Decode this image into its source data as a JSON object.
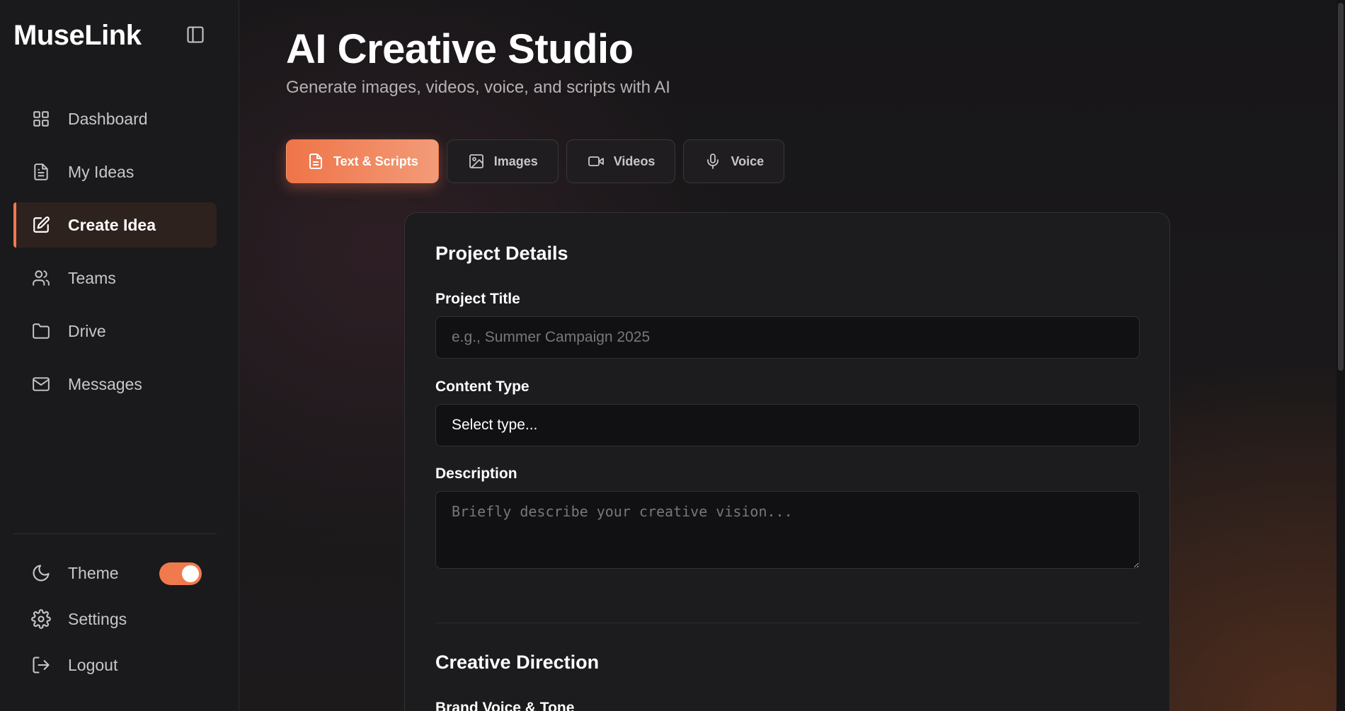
{
  "sidebar": {
    "logo": "MuseLink",
    "collapse_icon": "sidebar-toggle-icon",
    "items": [
      {
        "label": "Dashboard",
        "icon": "grid-icon",
        "active": false
      },
      {
        "label": "My Ideas",
        "icon": "document-icon",
        "active": false
      },
      {
        "label": "Create Idea",
        "icon": "pen-square-icon",
        "active": true
      },
      {
        "label": "Teams",
        "icon": "users-icon",
        "active": false
      },
      {
        "label": "Drive",
        "icon": "folder-icon",
        "active": false
      },
      {
        "label": "Messages",
        "icon": "mail-icon",
        "active": false
      }
    ],
    "theme": {
      "label": "Theme",
      "icon": "moon-icon",
      "enabled": true
    },
    "settings": {
      "label": "Settings",
      "icon": "gear-icon"
    },
    "logout": {
      "label": "Logout",
      "icon": "logout-icon"
    }
  },
  "main": {
    "title": "AI Creative Studio",
    "subtitle": "Generate images, videos, voice, and scripts with AI",
    "tabs": [
      {
        "label": "Text & Scripts",
        "icon": "document-icon",
        "active": true
      },
      {
        "label": "Images",
        "icon": "image-icon",
        "active": false
      },
      {
        "label": "Videos",
        "icon": "video-icon",
        "active": false
      },
      {
        "label": "Voice",
        "icon": "microphone-icon",
        "active": false
      }
    ],
    "project_details": {
      "title": "Project Details",
      "project_title_label": "Project Title",
      "project_title_placeholder": "e.g., Summer Campaign 2025",
      "project_title_value": "",
      "content_type_label": "Content Type",
      "content_type_value": "Select type...",
      "description_label": "Description",
      "description_placeholder": "Briefly describe your creative vision...",
      "description_value": ""
    },
    "creative_direction": {
      "title": "Creative Direction",
      "brand_voice_label": "Brand Voice & Tone"
    }
  },
  "colors": {
    "accent": "#f07a4e",
    "background": "#1a1a1c",
    "card": "#1c1b1d"
  }
}
